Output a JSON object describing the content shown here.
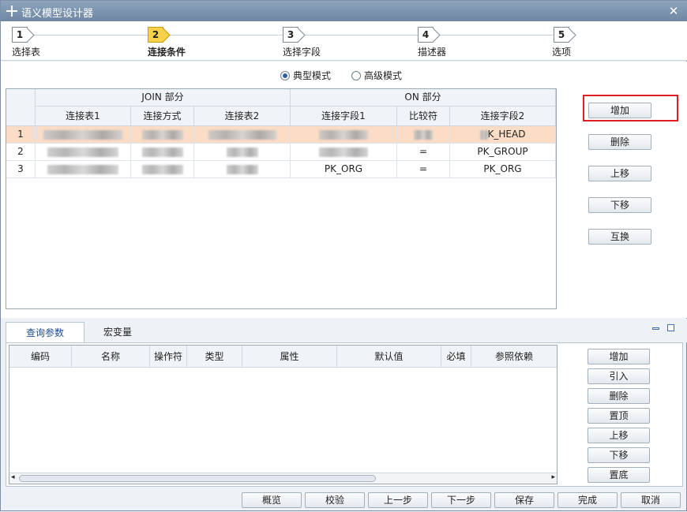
{
  "window": {
    "title": "语义模型设计器",
    "close_glyph": "✕"
  },
  "wizard": {
    "steps": [
      {
        "num": "1",
        "label": "选择表"
      },
      {
        "num": "2",
        "label": "连接条件"
      },
      {
        "num": "3",
        "label": "选择字段"
      },
      {
        "num": "4",
        "label": "描述器"
      },
      {
        "num": "5",
        "label": "选项"
      }
    ],
    "active_step": 2
  },
  "mode": {
    "typical": "典型模式",
    "advanced": "高级模式",
    "selected": "typical"
  },
  "join_table": {
    "group_headers": {
      "join": "JOIN 部分",
      "on": "ON 部分"
    },
    "columns": [
      "连接表1",
      "连接方式",
      "连接表2",
      "连接字段1",
      "比较符",
      "连接字段2"
    ],
    "rows": [
      {
        "num": "1",
        "field1": "",
        "comparator": "",
        "field2": "K_HEAD",
        "selected": true
      },
      {
        "num": "2",
        "field1": "",
        "comparator": "=",
        "field2": "PK_GROUP",
        "selected": false
      },
      {
        "num": "3",
        "field1": "PK_ORG",
        "comparator": "=",
        "field2": "PK_ORG",
        "selected": false
      }
    ]
  },
  "side_buttons": {
    "add": "增加",
    "delete": "删除",
    "move_up": "上移",
    "move_down": "下移",
    "swap": "互换"
  },
  "bottom_tabs": {
    "query_params": "查询参数",
    "macro_vars": "宏变量"
  },
  "param_table": {
    "columns": [
      "编码",
      "名称",
      "操作符",
      "类型",
      "属性",
      "默认值",
      "必填",
      "参照依赖"
    ]
  },
  "param_buttons": {
    "add": "增加",
    "import": "引入",
    "delete": "删除",
    "top": "置顶",
    "up": "上移",
    "down": "下移",
    "bottom": "置底"
  },
  "footer_buttons": {
    "preview": "概览",
    "validate": "校验",
    "prev": "上一步",
    "next": "下一步",
    "save": "保存",
    "finish": "完成",
    "cancel": "取消"
  },
  "colors": {
    "selected_row": "#fbdcc6",
    "active_step": "#f8d24b",
    "highlight_box": "#e02020"
  }
}
